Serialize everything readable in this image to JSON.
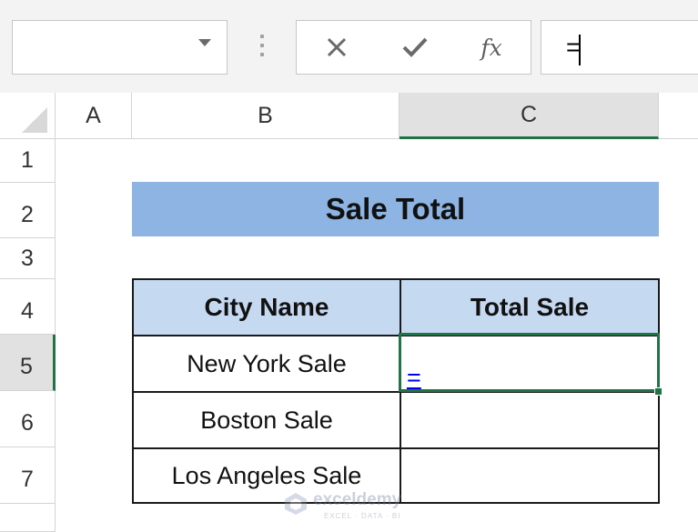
{
  "formula_bar": {
    "name_box_value": "",
    "fx_label": "fx",
    "formula_value": "="
  },
  "columns": [
    "A",
    "B",
    "C"
  ],
  "rows": [
    "1",
    "2",
    "3",
    "4",
    "5",
    "6",
    "7"
  ],
  "sheet": {
    "title": "Sale Total",
    "table_headers": [
      "City Name",
      "Total Sale"
    ],
    "cities": [
      "New York Sale",
      "Boston Sale",
      "Los Angeles Sale"
    ],
    "active_cell_value": "="
  },
  "watermark": {
    "name": "exceldemy",
    "tagline": "EXCEL · DATA · BI"
  },
  "colors": {
    "selection_green": "#217346",
    "title_fill": "#8db4e2",
    "header_fill": "#c5d9f1",
    "link_blue": "#0000ee"
  },
  "icons": [
    "dropdown-caret-icon",
    "cancel-icon",
    "enter-check-icon",
    "insert-function-icon"
  ]
}
